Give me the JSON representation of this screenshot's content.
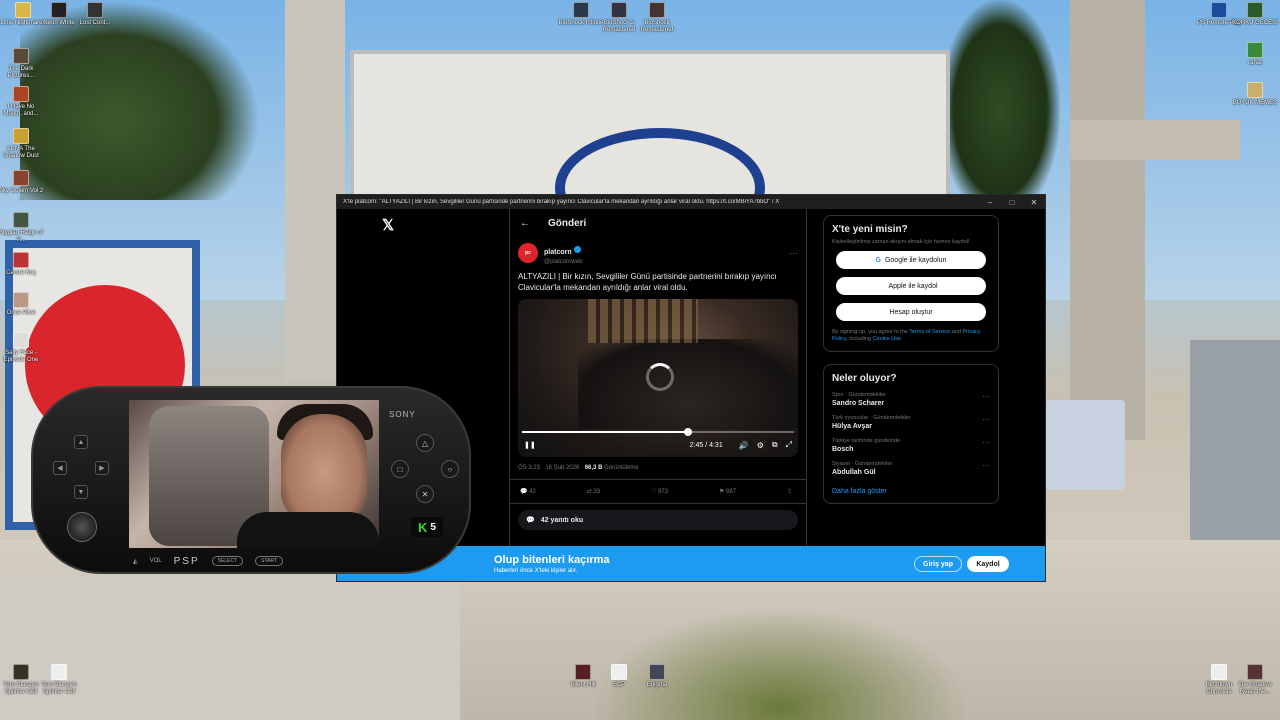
{
  "desktop": {
    "icons_left": [
      {
        "label": "Little Nightmares"
      },
      {
        "label": "Neon White"
      },
      {
        "label": "Lost Cont..."
      },
      {
        "label": "The Dark Pictures..."
      },
      {
        "label": "I Have No Mouth, and..."
      },
      {
        "label": "LUNA The Shadow Dust"
      },
      {
        "label": "Sky Golem Vol 2 ..."
      },
      {
        "label": "Stygian Reign of Ti..."
      },
      {
        "label": "Cemre Koç"
      },
      {
        "label": "Once Alive"
      },
      {
        "label": "Sally Face - Episode One"
      }
    ],
    "icons_top": [
      {
        "label": "BioShock Infinite"
      },
      {
        "label": "BioShock 2 Remastered"
      },
      {
        "label": "BioShock Remastered"
      }
    ],
    "icons_right": [
      {
        "label": "PS Remote Play"
      },
      {
        "label": "KORKU GECESİ"
      },
      {
        "label": "rahat"
      },
      {
        "label": "BÜYÜK MEMES"
      }
    ],
    "icons_bottom": [
      {
        "label": "Tom Clancy's Splinter Cell"
      },
      {
        "label": "Tom Clancy's Splinter Cell"
      },
      {
        "label": "Silent Hill"
      },
      {
        "label": "SCP"
      },
      {
        "label": "Enigma"
      },
      {
        "label": "Birchtown Chronicle"
      },
      {
        "label": "The Shadow Reels the..."
      }
    ]
  },
  "browser": {
    "window_title": "X'te platcorn: \"ALTYAZILI | Bir kızın, Sevgililer Günü partisinde partnerini bırakıp yayıncı Clavicular'la mekandan ayrıldığı anlar viral oldu. https://t.co/MBiYA7bbO\" / X",
    "minimize": "–",
    "maximize": "□",
    "close": "✕"
  },
  "x": {
    "logo": "𝕏",
    "header": {
      "back": "←",
      "title": "Gönderi"
    },
    "post": {
      "avatar_text": "pc",
      "name": "platcorn",
      "handle": "@platcornweb",
      "more": "···",
      "text": "ALTYAZILI | Bir kızın, Sevgililer Günü partisinde partnerini bırakıp yayıncı Clavicular'la mekandan ayrıldığı anlar viral oldu.",
      "video": {
        "progress": 0.61,
        "time": "2:45 / 4:31",
        "play_icon": "❚❚"
      },
      "meta": {
        "time": "ÖS 3:23 · 16 Şub 2026 · ",
        "views": "66,3 B",
        "views_label": "Görüntüleme"
      },
      "actions": {
        "replies": "42",
        "reposts": "33",
        "likes": "973",
        "bookmarks": "887"
      },
      "read_replies": "42 yanıtı oku"
    },
    "new_card": {
      "title": "X'te yeni misin?",
      "subtitle": "Kişiselleştirilmiş zaman akışını almak için hemen kaydol!",
      "google": "Google ile kaydolun",
      "apple": "Apple ile kaydol",
      "create": "Hesap oluştur",
      "legal_prefix": "By signing up, you agree to the ",
      "terms": "Terms of Service",
      "and": " and ",
      "privacy": "Privacy Policy",
      "including": ", including ",
      "cookie": "Cookie Use."
    },
    "trends": {
      "title": "Neler oluyor?",
      "items": [
        {
          "category": "Spor · Gündemdekiler",
          "name": "Sandro Scharer"
        },
        {
          "category": "Türk oyuncular · Gündemdekiler",
          "name": "Hülya Avşar"
        },
        {
          "category": "Türkiye tarihinde gündemde",
          "name": "Bosch"
        },
        {
          "category": "Siyaset · Gündemdekiler",
          "name": "Abdullah Gül"
        }
      ],
      "show_more": "Daha fazla göster"
    },
    "banner": {
      "title": "Olup bitenleri kaçırma",
      "subtitle": "Haberleri önce X'teki kişiler alır.",
      "login": "Giriş yap",
      "signup": "Kaydol"
    }
  },
  "psp": {
    "brand": "SONY",
    "logo": "PSP",
    "vol": "VOL",
    "select": "SELECT",
    "start": "START",
    "badge_letter": "K",
    "badge_number": "5"
  }
}
